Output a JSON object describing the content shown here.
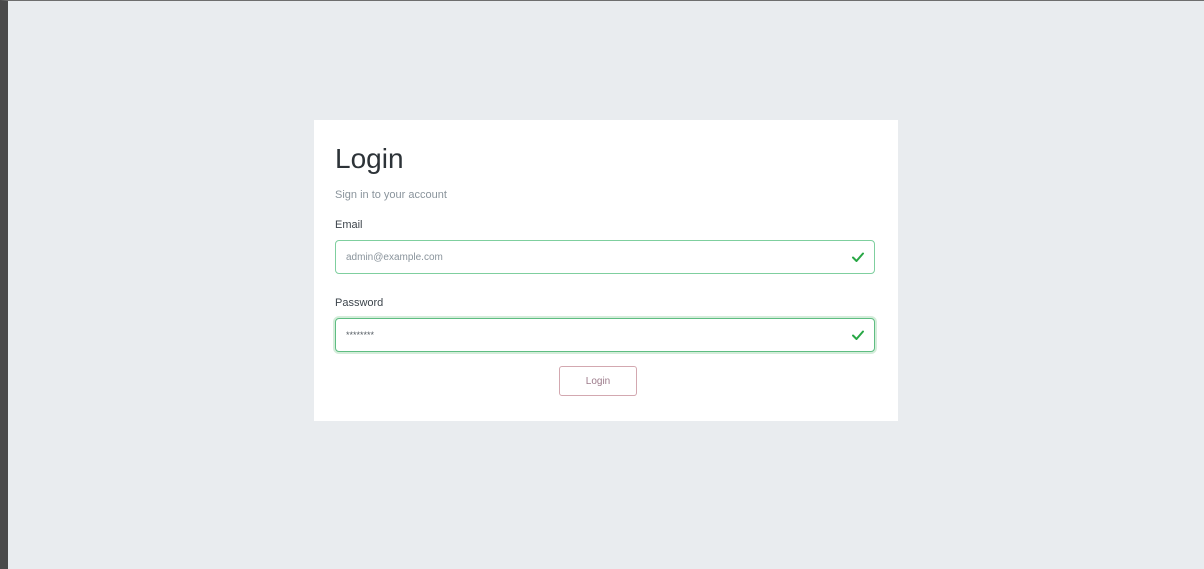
{
  "login": {
    "title": "Login",
    "subtitle": "Sign in to your account",
    "email": {
      "label": "Email",
      "value": "admin@example.com"
    },
    "password": {
      "label": "Password",
      "value": "********"
    },
    "submit_label": "Login"
  },
  "colors": {
    "page_background": "#e9ecef",
    "card_background": "#ffffff",
    "valid_border": "#7fcf9f",
    "valid_icon": "#28a745",
    "button_border": "#d3a8b0"
  },
  "icons": {
    "email_valid": "check-icon",
    "password_valid": "check-icon"
  }
}
